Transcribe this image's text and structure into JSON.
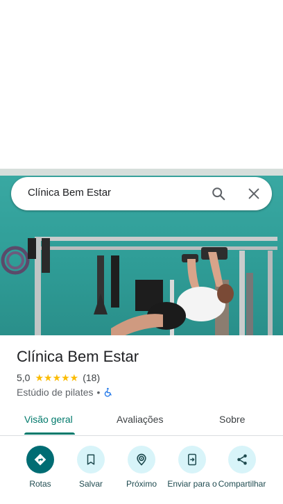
{
  "search": {
    "query": "Clínica Bem Estar"
  },
  "place": {
    "name": "Clínica Bem Estar",
    "rating": "5,0",
    "stars": "★★★★★",
    "review_count": "(18)",
    "category": "Estúdio de pilates",
    "separator": "•"
  },
  "tabs": [
    {
      "label": "Visão geral",
      "active": true
    },
    {
      "label": "Avaliações",
      "active": false
    },
    {
      "label": "Sobre",
      "active": false
    }
  ],
  "actions": [
    {
      "label": "Rotas",
      "icon": "directions-icon"
    },
    {
      "label": "Salvar",
      "icon": "bookmark-icon"
    },
    {
      "label": "Próximo",
      "icon": "nearby-icon"
    },
    {
      "label": "Enviar para o",
      "icon": "send-to-phone-icon"
    },
    {
      "label": "Compartilhar",
      "icon": "share-icon"
    }
  ],
  "colors": {
    "accent": "#00796b",
    "primary_button": "#006c73",
    "action_bg": "#d8f4f9",
    "star": "#fbbc04"
  }
}
